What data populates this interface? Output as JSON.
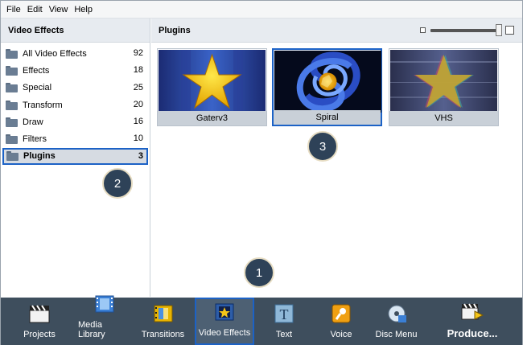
{
  "menu": [
    "File",
    "Edit",
    "View",
    "Help"
  ],
  "left_panel": {
    "title": "Video Effects",
    "categories": [
      {
        "label": "All Video Effects",
        "count": "92"
      },
      {
        "label": "Effects",
        "count": "18"
      },
      {
        "label": "Special",
        "count": "25"
      },
      {
        "label": "Transform",
        "count": "20"
      },
      {
        "label": "Draw",
        "count": "16"
      },
      {
        "label": "Filters",
        "count": "10"
      },
      {
        "label": "Plugins",
        "count": "3",
        "selected": true
      }
    ]
  },
  "right_panel": {
    "title": "Plugins",
    "zoom_level": 1.0,
    "items": [
      {
        "label": "Gaterv3",
        "icon": "star-icon"
      },
      {
        "label": "Spiral",
        "icon": "spiral-icon",
        "selected": true
      },
      {
        "label": "VHS",
        "icon": "star-icon"
      }
    ]
  },
  "markers": [
    "1",
    "2",
    "3"
  ],
  "toolbar": {
    "items": [
      {
        "label": "Projects",
        "icon": "clapperboard-icon"
      },
      {
        "label": "Media Library",
        "icon": "film-strip-icon"
      },
      {
        "label": "Transitions",
        "icon": "transition-icon"
      },
      {
        "label": "Video Effects",
        "icon": "effects-star-icon",
        "selected": true
      },
      {
        "label": "Text",
        "icon": "text-icon"
      },
      {
        "label": "Voice",
        "icon": "microphone-icon"
      },
      {
        "label": "Disc Menu",
        "icon": "disc-icon"
      },
      {
        "label": "Produce...",
        "icon": "produce-icon"
      }
    ]
  },
  "colors": {
    "selection_border": "#1c62c6",
    "toolbar_bg": "#3e4e5d",
    "marker_bg": "#2e4258"
  }
}
